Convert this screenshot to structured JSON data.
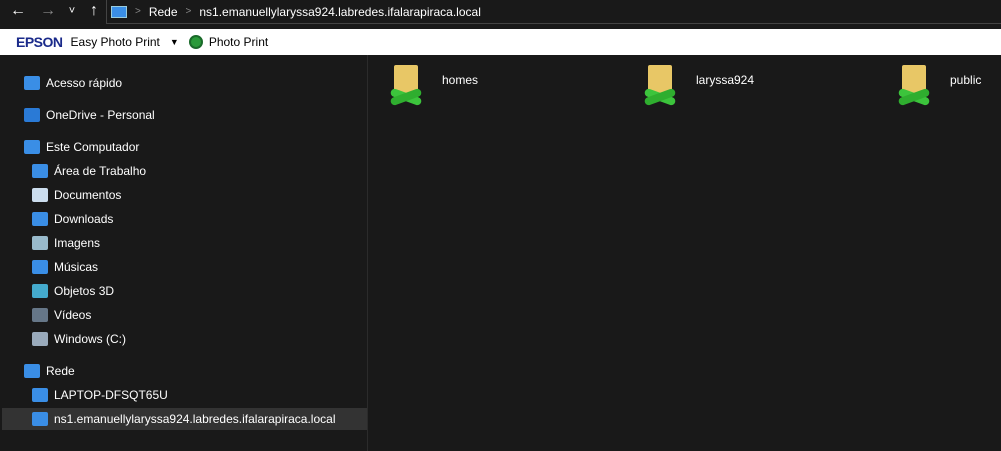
{
  "nav": {
    "back": "←",
    "forward": "→",
    "recent": "˅",
    "up": "↑"
  },
  "address": {
    "crumbs": [
      "Rede",
      "ns1.emanuellylaryssa924.labredes.ifalarapiraca.local"
    ]
  },
  "toolbar": {
    "brand": "EPSON",
    "app": "Easy Photo Print",
    "photo_print": "Photo Print"
  },
  "sidebar": {
    "items": [
      {
        "label": "Acesso rápido",
        "icon": "star-icon",
        "color": "#3a8ee6"
      },
      {
        "label": "OneDrive - Personal",
        "icon": "cloud-icon",
        "color": "#2a7ad6"
      },
      {
        "label": "Este Computador",
        "icon": "computer-icon",
        "color": "#3a8ee6"
      },
      {
        "label": "Área de Trabalho",
        "icon": "desktop-icon",
        "color": "#3a8ee6"
      },
      {
        "label": "Documentos",
        "icon": "document-icon",
        "color": "#cde"
      },
      {
        "label": "Downloads",
        "icon": "download-icon",
        "color": "#3a8ee6"
      },
      {
        "label": "Imagens",
        "icon": "image-icon",
        "color": "#9bc"
      },
      {
        "label": "Músicas",
        "icon": "music-icon",
        "color": "#3a8ee6"
      },
      {
        "label": "Objetos 3D",
        "icon": "cube-icon",
        "color": "#4ac"
      },
      {
        "label": "Vídeos",
        "icon": "video-icon",
        "color": "#678"
      },
      {
        "label": "Windows (C:)",
        "icon": "drive-icon",
        "color": "#9ab"
      },
      {
        "label": "Rede",
        "icon": "network-icon",
        "color": "#3a8ee6"
      },
      {
        "label": "LAPTOP-DFSQT65U",
        "icon": "computer-icon",
        "color": "#3a8ee6"
      },
      {
        "label": "ns1.emanuellylaryssa924.labredes.ifalarapiraca.local",
        "icon": "computer-icon",
        "color": "#3a8ee6"
      }
    ]
  },
  "folders": [
    {
      "name": "homes"
    },
    {
      "name": "laryssa924"
    },
    {
      "name": "public"
    }
  ]
}
